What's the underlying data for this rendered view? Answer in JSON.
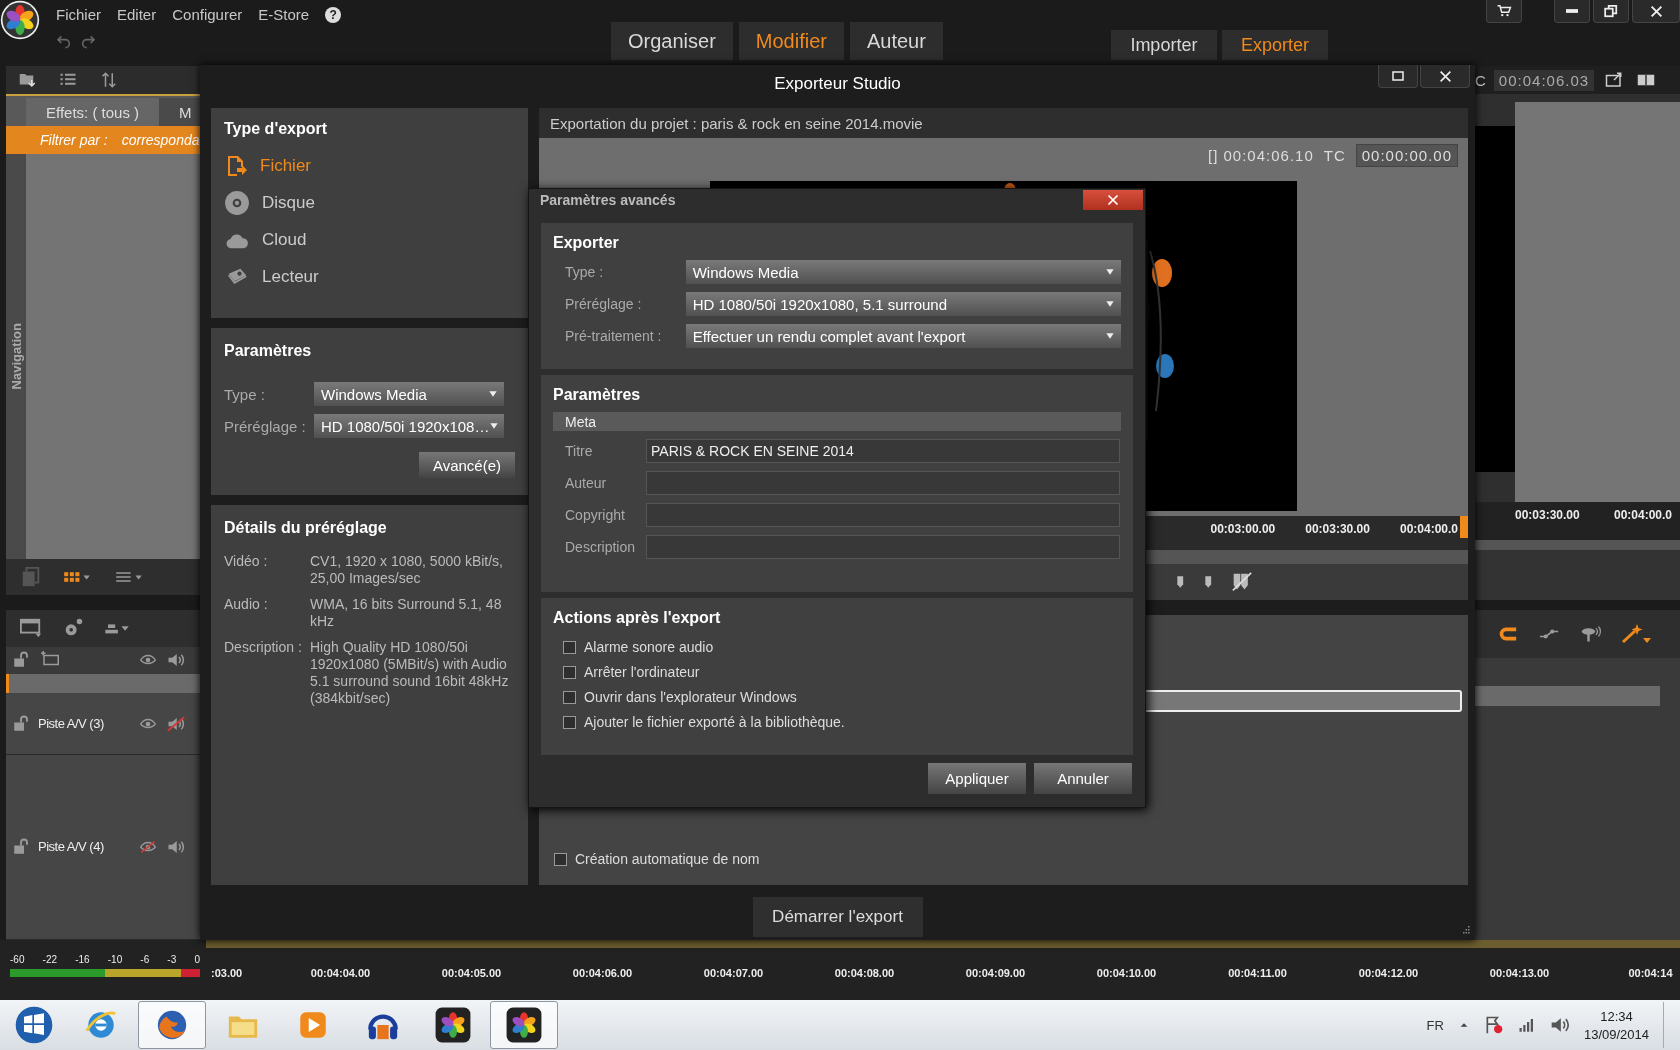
{
  "app_menu": [
    "Fichier",
    "Editer",
    "Configurer",
    "E-Store",
    "?"
  ],
  "modes": [
    {
      "label": "Organiser",
      "selected": false
    },
    {
      "label": "Modifier",
      "selected": true
    },
    {
      "label": "Auteur",
      "selected": false
    }
  ],
  "actions": [
    {
      "label": "Importer",
      "selected": false
    },
    {
      "label": "Exporter",
      "selected": true
    }
  ],
  "library": {
    "tabs": [
      {
        "label": "Effets: ( tous )",
        "selected": true
      },
      {
        "label": "M",
        "selected": false
      }
    ],
    "filter_label": "Filtrer par :",
    "filter_value": "corresponda",
    "side_label": "Navigation"
  },
  "player": {
    "tc_label": "C",
    "timecode": "00:04:06.03",
    "ruler": [
      "00:03:30.00",
      "00:04:00.0"
    ]
  },
  "timeline": {
    "tracks": [
      {
        "name": "Piste A/V (3)",
        "visible": true,
        "muted": true
      },
      {
        "name": "Piste A/V (4)",
        "visible": false,
        "muted": false
      }
    ],
    "meter_scale": [
      "-60",
      "-22",
      "-16",
      "-10",
      "-6",
      "-3",
      "0"
    ],
    "ruler": [
      ":03.00",
      "00:04:04.00",
      "00:04:05.00",
      "00:04:06.00",
      "00:04:07.00",
      "00:04:08.00",
      "00:04:09.00",
      "00:04:10.00",
      "00:04:11.00",
      "00:04:12.00",
      "00:04:13.00",
      "00:04:14"
    ]
  },
  "exporter": {
    "title": "Exporteur Studio",
    "type_title": "Type d'export",
    "export_types": [
      {
        "label": "Fichier",
        "selected": true,
        "kind": "file"
      },
      {
        "label": "Disque",
        "selected": false,
        "kind": "disc"
      },
      {
        "label": "Cloud",
        "selected": false,
        "kind": "cloud"
      },
      {
        "label": "Lecteur",
        "selected": false,
        "kind": "device"
      }
    ],
    "params_title": "Paramètres",
    "params": [
      {
        "label": "Type :",
        "value": "Windows Media"
      },
      {
        "label": "Préréglage :",
        "value": "HD 1080/50i 1920x108…"
      }
    ],
    "advanced_button": "Avancé(e)",
    "details_title": "Détails du préréglage",
    "details": [
      {
        "label": "Vidéo :",
        "value": "CV1, 1920 x 1080, 5000 kBit/s, 25,00 Images/sec"
      },
      {
        "label": "Audio :",
        "value": "WMA, 16 bits Surround 5.1, 48 kHz"
      },
      {
        "label": "Description :",
        "value": "High Quality HD 1080/50i 1920x1080 (5MBit/s) with Audio 5.1 surround sound 16bit 48kHz (384kbit/sec)"
      }
    ],
    "project": "Exportation du projet : paris & rock en seine 2014.movie",
    "duration": "[] 00:04:06.10",
    "tc_label": "TC",
    "tc": "00:00:00.00",
    "ruler": [
      "00:03:00.00",
      "00:03:30.00",
      "00:04:00.0"
    ],
    "auto_name": {
      "label": "Création automatique de nom",
      "checked": false
    },
    "start_button": "Démarrer l'export"
  },
  "advanced": {
    "title": "Paramètres avancés",
    "exporter_title": "Exporter",
    "fields": [
      {
        "label": "Type :",
        "value": "Windows Media"
      },
      {
        "label": "Préréglage :",
        "value": "HD 1080/50i 1920x1080, 5.1 surround"
      },
      {
        "label": "Pré-traitement :",
        "value": "Effectuer un rendu complet avant l'export"
      }
    ],
    "params_title": "Paramètres",
    "meta_title": "Meta",
    "meta": [
      {
        "label": "Titre",
        "value": "PARIS & ROCK EN SEINE 2014"
      },
      {
        "label": "Auteur"
      },
      {
        "label": "Copyright"
      },
      {
        "label": "Description"
      }
    ],
    "actions_title": "Actions après l'export",
    "actions": [
      {
        "label": "Alarme sonore audio",
        "checked": false
      },
      {
        "label": "Arrêter l'ordinateur",
        "checked": false
      },
      {
        "label": "Ouvrir dans l'explorateur Windows",
        "checked": false
      },
      {
        "label": "Ajouter le fichier exporté à la bibliothèque.",
        "checked": false
      }
    ],
    "buttons": [
      "Appliquer",
      "Annuler"
    ]
  },
  "taskbar": {
    "apps": [
      {
        "kind": "browser-e",
        "open": false
      },
      {
        "kind": "browser-fox",
        "open": true
      },
      {
        "kind": "folder",
        "open": false
      },
      {
        "kind": "player",
        "open": false
      },
      {
        "kind": "headphones",
        "open": false
      },
      {
        "kind": "pinwheel",
        "open": false
      },
      {
        "kind": "pinwheel",
        "open": true
      }
    ],
    "lang": "FR",
    "time": "12:34",
    "date": "13/09/2014"
  }
}
